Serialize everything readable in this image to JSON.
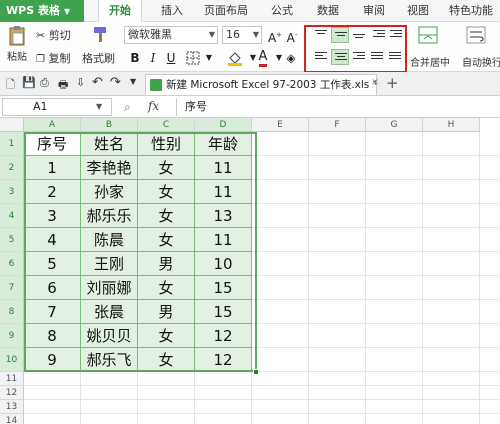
{
  "app": {
    "name": "WPS 表格"
  },
  "ribbon_tabs": [
    "开始",
    "插入",
    "页面布局",
    "公式",
    "数据",
    "审阅",
    "视图",
    "特色功能"
  ],
  "active_tab": "开始",
  "clipboard": {
    "paste": "粘贴",
    "cut": "剪切",
    "copy": "复制",
    "format_painter": "格式刷"
  },
  "font": {
    "name": "微软雅黑",
    "size": "16"
  },
  "format_buttons": [
    "B",
    "I",
    "U"
  ],
  "colors": {
    "accent": "#3fa24d",
    "highlight": "#d32020",
    "table_fill": "#e3f1e3",
    "table_border": "#5ea75e",
    "font_color": "#d32020",
    "fill_color": "#f2c200"
  },
  "merge": {
    "label": "合并居中"
  },
  "wrap": {
    "label": "自动换行"
  },
  "document_tab": {
    "title": "新建 Microsoft Excel 97-2003 工作表.xls *"
  },
  "formula_bar": {
    "name_box": "A1",
    "fx": "fx",
    "content": "序号"
  },
  "columns": [
    "A",
    "B",
    "C",
    "D",
    "E",
    "F",
    "G",
    "H"
  ],
  "rows": [
    "1",
    "2",
    "3",
    "4",
    "5",
    "6",
    "7",
    "8",
    "9",
    "10",
    "11",
    "12",
    "13",
    "14"
  ],
  "table": {
    "headers": [
      "序号",
      "姓名",
      "性别",
      "年龄"
    ],
    "rows": [
      [
        "1",
        "李艳艳",
        "女",
        "11"
      ],
      [
        "2",
        "孙家",
        "女",
        "11"
      ],
      [
        "3",
        "郝乐乐",
        "女",
        "13"
      ],
      [
        "4",
        "陈晨",
        "女",
        "11"
      ],
      [
        "5",
        "王刚",
        "男",
        "10"
      ],
      [
        "6",
        "刘丽娜",
        "女",
        "15"
      ],
      [
        "7",
        "张晨",
        "男",
        "15"
      ],
      [
        "8",
        "姚贝贝",
        "女",
        "12"
      ],
      [
        "9",
        "郝乐飞",
        "女",
        "12"
      ]
    ]
  }
}
